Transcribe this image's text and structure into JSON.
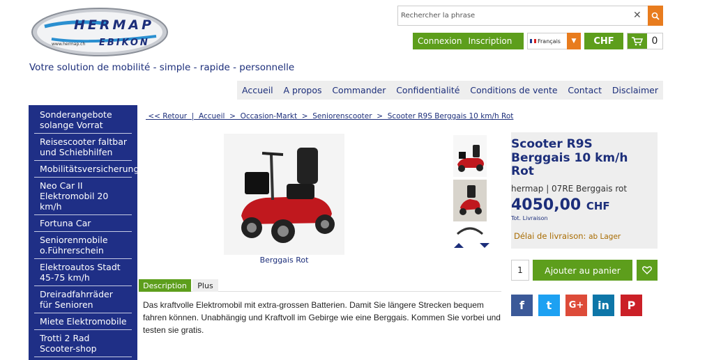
{
  "logo": {
    "line1": "HERMAP",
    "line2": "EBIKON",
    "url": "www.hermap.ch"
  },
  "search": {
    "placeholder": "Rechercher la phrase"
  },
  "auth": {
    "login": "Connexion",
    "register": "Inscription"
  },
  "language": {
    "selected": "Français"
  },
  "currency": "CHF",
  "cart": {
    "count": "0"
  },
  "tagline": "Votre solution de mobilité - simple - rapide - personnelle",
  "nav": [
    "Accueil",
    "A propos",
    "Commander",
    "Confidentialité",
    "Conditions de vente",
    "Contact",
    "Disclaimer"
  ],
  "sidebar": {
    "items": [
      [
        "Sonderangebote",
        "solange Vorrat"
      ],
      [
        "Reisescooter faltbar",
        "und Schiebhilfen"
      ],
      [
        "Mobilitätsversicherung"
      ],
      [
        "Neo Car II",
        "Elektromobil 20",
        "km/h"
      ],
      [
        "Fortuna Car"
      ],
      [
        "Seniorenmobile",
        "o.Führerschein"
      ],
      [
        "Elektroautos Stadt",
        "45-75 km/h"
      ],
      [
        "Dreiradfahrräder",
        "für Senioren"
      ],
      [
        "Miete Elektromobile"
      ],
      [
        "Trotti 2 Rad",
        "Scooter-shop"
      ]
    ]
  },
  "breadcrumb": " << Retour  |  Accueil  >  Occasion-Markt  >  Seniorenscooter  >  Scooter R9S Berggais 10 km/h Rot",
  "product": {
    "title": "Scooter R9S Berggais 10 km/h Rot",
    "brand": "hermap",
    "sku": "07RE Berggais rot",
    "price": "4050,00",
    "currency": "CHF",
    "tax_note": "Tot. Livraison",
    "delivery_label": "Délai de livraison:",
    "delivery_value": "ab Lager",
    "image_caption": "Berggais Rot",
    "quantity": "1",
    "add_to_cart": "Ajouter au panier"
  },
  "tabs": [
    "Description",
    "Plus"
  ],
  "description": "Das kraftvolle Elektromobil mit extra-grossen Batterien. Damit Sie längere Strecken bequem fahren können. Unabhängig und Kraftvoll im Gebirge wie eine Berggais. Kommen Sie vorbei und testen sie gratis.",
  "social": [
    {
      "name": "facebook",
      "glyph": "f",
      "color": "#3b5998"
    },
    {
      "name": "twitter",
      "glyph": "t",
      "color": "#1da1f2"
    },
    {
      "name": "google-plus",
      "glyph": "G+",
      "color": "#dd4b39"
    },
    {
      "name": "linkedin",
      "glyph": "in",
      "color": "#0e76a8"
    },
    {
      "name": "pinterest",
      "glyph": "P",
      "color": "#cb2027"
    }
  ],
  "colors": {
    "green": "#5d9e1c",
    "navy": "#1f2f86",
    "orange": "#e87c1e"
  }
}
